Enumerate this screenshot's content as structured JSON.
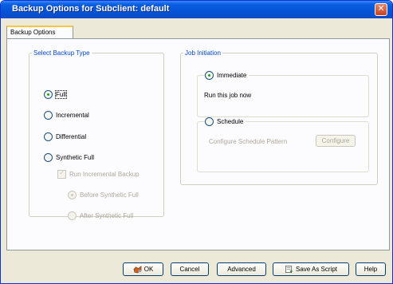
{
  "window": {
    "title": "Backup Options for Subclient: default",
    "close_glyph": "✕"
  },
  "tabs": [
    {
      "label": "Backup Options"
    }
  ],
  "backup_type": {
    "legend": "Select Backup Type",
    "full": "Full",
    "incremental": "Incremental",
    "differential": "Differential",
    "synthetic_full": "Synthetic Full",
    "run_incremental": "Run Incremental Backup",
    "before_synthetic": "Before Synthetic Full",
    "after_synthetic": "After Synthetic Full"
  },
  "job_initiation": {
    "legend": "Job Initiation",
    "immediate": "Immediate",
    "run_now_text": "Run this job now",
    "schedule": "Schedule",
    "configure_pattern_label": "Configure Schedule Pattern",
    "configure_button": "Configure"
  },
  "buttons": {
    "ok": "OK",
    "cancel": "Cancel",
    "advanced": "Advanced",
    "save_as_script": "Save As Script",
    "help": "Help"
  },
  "icons": {
    "ok": "ok-hand-icon",
    "script": "script-icon",
    "close": "close-icon"
  },
  "colors": {
    "title_bar": "#0653d6",
    "legend_text": "#0046d5",
    "selected_radio_dot": "#21a121"
  }
}
